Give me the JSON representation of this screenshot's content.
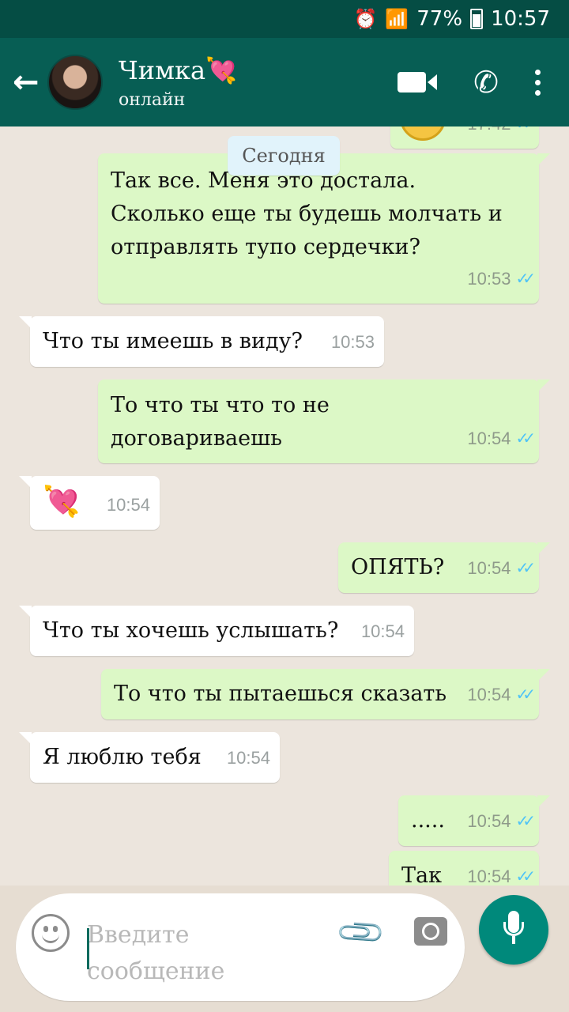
{
  "status_bar": {
    "battery": "77%",
    "time": "10:57"
  },
  "header": {
    "contact_name": "Чимка💘",
    "contact_status": "онлайн"
  },
  "chat": {
    "date_label": "Сегодня",
    "partial_top_time": "17:42",
    "messages": [
      {
        "dir": "out",
        "text": "Так все. Меня это достала. Сколько еще ты будешь молчать и отправлять тупо сердечки?",
        "time": "10:53"
      },
      {
        "dir": "in",
        "text": "Что ты имеешь в виду?",
        "time": "10:53"
      },
      {
        "dir": "out",
        "text": "То что ты что то не договариваешь",
        "time": "10:54"
      },
      {
        "dir": "in",
        "text": "💘",
        "time": "10:54"
      },
      {
        "dir": "out",
        "text": "ОПЯТЬ?",
        "time": "10:54"
      },
      {
        "dir": "in",
        "text": "Что ты хочешь услышать?",
        "time": "10:54"
      },
      {
        "dir": "out",
        "text": "То что ты пытаешься сказать",
        "time": "10:54"
      },
      {
        "dir": "in",
        "text": "Я люблю тебя",
        "time": "10:54"
      },
      {
        "dir": "out",
        "text": ".....",
        "time": "10:54"
      },
      {
        "dir": "out",
        "text": "Так",
        "time": "10:54"
      }
    ]
  },
  "composer": {
    "placeholder": "Введите сообщение"
  },
  "icons": {
    "back": "arrow-left-icon",
    "video": "video-call-icon",
    "phone": "phone-icon",
    "menu": "more-vert-icon",
    "emoji": "emoji-icon",
    "attach": "paperclip-icon",
    "camera": "camera-icon",
    "mic": "microphone-icon"
  },
  "colors": {
    "header": "#075e54",
    "statusbar": "#054d44",
    "outgoing_bubble": "#dcf8c6",
    "incoming_bubble": "#ffffff",
    "read_ticks": "#4fc3f7",
    "mic_button": "#00897b"
  }
}
